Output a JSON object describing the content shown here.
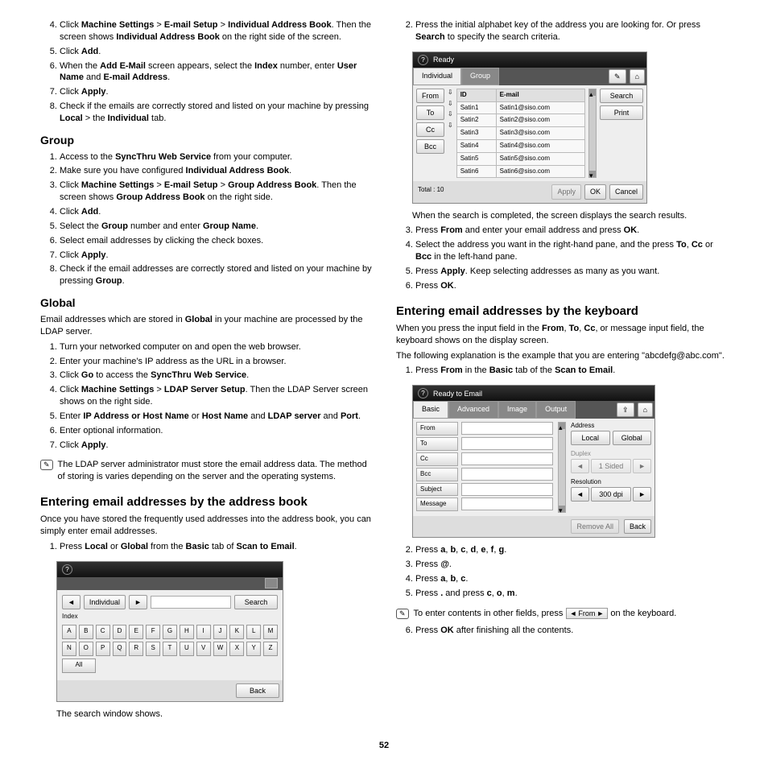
{
  "page_number": "52",
  "left": {
    "top_steps": [
      "Click <b>Machine Settings</b> > <b>E-mail Setup</b> > <b>Individual Address Book</b>. Then the screen shows <b>Individual Address Book</b> on the right side of the screen.",
      "Click <b>Add</b>.",
      "When the <b>Add E-Mail</b> screen appears, select the <b>Index</b> number, enter <b>User Name</b> and <b>E-mail Address</b>.",
      "Click <b>Apply</b>.",
      "Check if the emails are correctly stored and listed on your machine by pressing <b>Local</b> > the <b>Individual</b> tab."
    ],
    "group_heading": "Group",
    "group_steps": [
      "Access to the <b>SyncThru Web Service</b> from your computer.",
      "Make sure you have configured <b>Individual Address Book</b>.",
      "Click <b>Machine Settings</b> > <b>E-mail Setup</b> > <b>Group Address Book</b>. Then the screen shows <b>Group Address Book</b> on the right side.",
      "Click <b>Add</b>.",
      "Select the <b>Group</b> number and enter <b>Group Name</b>.",
      "Select email addresses by clicking the check boxes.",
      "Click <b>Apply</b>.",
      "Check if the email addresses are correctly stored and listed on your machine by pressing <b>Group</b>."
    ],
    "global_heading": "Global",
    "global_intro": "Email addresses which are stored in <b>Global</b> in your machine are processed by the LDAP server.",
    "global_steps": [
      "Turn your networked computer on and open the web browser.",
      "Enter your machine's IP address as the URL in a browser.",
      "Click <b>Go</b> to access the <b>SyncThru Web Service</b>.",
      "Click <b>Machine Settings</b> > <b>LDAP Server Setup</b>. Then the LDAP Server screen shows on the right side.",
      "Enter <b>IP Address or Host Name</b> or <b>Host Name</b> and <b>LDAP server</b> and <b>Port</b>.",
      "Enter optional information.",
      "Click <b>Apply</b>."
    ],
    "global_note": "The LDAP server administrator must store the email address data. The method of storing is varies depending on the server and the operating systems.",
    "addrbook_heading": "Entering email addresses by the address book",
    "addrbook_intro": "Once you have stored the frequently used addresses into the address book, you can simply enter email addresses.",
    "addrbook_step1": "Press <b>Local</b> or <b>Global</b> from the <b>Basic</b> tab of <b>Scan to Email</b>.",
    "ss1": {
      "individual": "Individual",
      "search": "Search",
      "index": "Index",
      "all": "All",
      "back": "Back",
      "keys_row1": [
        "A",
        "B",
        "C",
        "D",
        "E",
        "F",
        "G",
        "H",
        "I",
        "J",
        "K",
        "L",
        "M"
      ],
      "keys_row2": [
        "N",
        "O",
        "P",
        "Q",
        "R",
        "S",
        "T",
        "U",
        "V",
        "W",
        "X",
        "Y",
        "Z"
      ]
    },
    "ss1_caption": "The search window shows."
  },
  "right": {
    "step2": "Press the initial alphabet key of the address you are looking for. Or press <b>Search</b> to specify the search criteria.",
    "ss2": {
      "ready": "Ready",
      "tab_individual": "Individual",
      "tab_group": "Group",
      "from": "From",
      "to": "To",
      "cc": "Cc",
      "bcc": "Bcc",
      "col_id": "ID",
      "col_email": "E-mail",
      "rows": [
        [
          "Satin1",
          "Satin1@siso.com"
        ],
        [
          "Satin2",
          "Satin2@siso.com"
        ],
        [
          "Satin3",
          "Satin3@siso.com"
        ],
        [
          "Satin4",
          "Satin4@siso.com"
        ],
        [
          "Satin5",
          "Satin5@siso.com"
        ],
        [
          "Satin6",
          "Satin6@siso.com"
        ]
      ],
      "search": "Search",
      "print": "Print",
      "total": "Total : 10",
      "apply": "Apply",
      "ok": "OK",
      "cancel": "Cancel"
    },
    "after_ss2": "When the search is completed, the screen displays the search results.",
    "steps_3_6": [
      "Press <b>From</b> and enter your email address and press <b>OK</b>.",
      "Select the address you want in the right-hand pane, and the press <b>To</b>, <b>Cc</b> or <b>Bcc</b> in the left-hand pane.",
      "Press <b>Apply</b>. Keep selecting addresses as many as you want.",
      "Press <b>OK</b>."
    ],
    "keyboard_heading": "Entering email addresses by the keyboard",
    "keyboard_p1": "When you press the input field in the <b>From</b>, <b>To</b>, <b>Cc</b>, or message input field, the keyboard shows on the display screen.",
    "keyboard_p2": "The following explanation is the example that you are entering \"abcdefg@abc.com\".",
    "keyboard_step1": "Press <b>From</b> in the <b>Basic</b> tab of the <b>Scan to Email</b>.",
    "ss3": {
      "ready": "Ready to Email",
      "tabs": [
        "Basic",
        "Advanced",
        "Image",
        "Output"
      ],
      "fields": [
        "From",
        "To",
        "Cc",
        "Bcc",
        "Subject",
        "Message"
      ],
      "address": "Address",
      "local": "Local",
      "global": "Global",
      "duplex": "Duplex",
      "sided": "1 Sided",
      "resolution": "Resolution",
      "dpi": "300 dpi",
      "remove": "Remove All",
      "back": "Back"
    },
    "steps_2_5": [
      "Press <b>a</b>, <b>b</b>, <b>c</b>, <b>d</b>, <b>e</b>, <b>f</b>, <b>g</b>.",
      "Press <b>@</b>.",
      "Press <b>a</b>, <b>b</b>, <b>c</b>.",
      "Press <b>.</b> and press <b>c</b>, <b>o</b>, <b>m</b>."
    ],
    "note2_pre": "To enter contents in other fields, press",
    "note2_btn": "From",
    "note2_post": "on the keyboard.",
    "step6": "Press <b>OK</b> after finishing all the contents."
  }
}
